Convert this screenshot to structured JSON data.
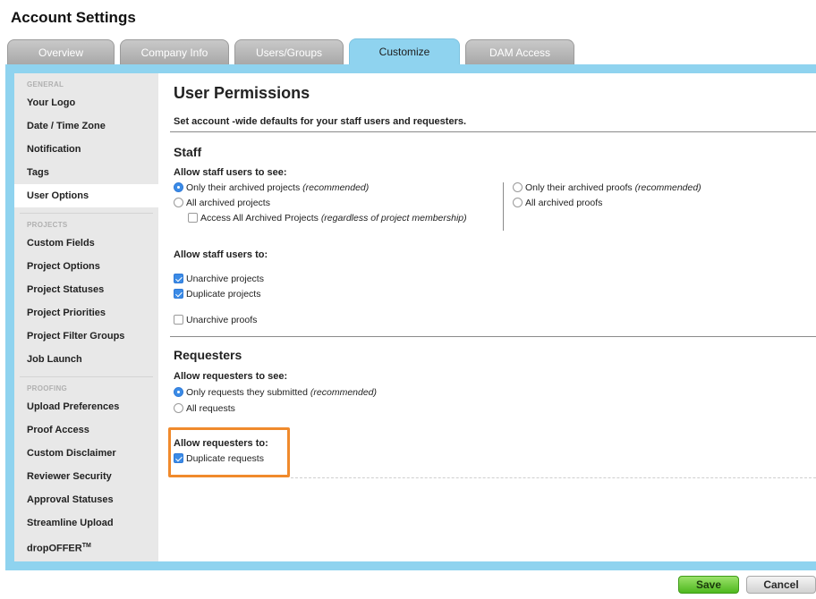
{
  "page_title": "Account Settings",
  "tabs": [
    {
      "label": "Overview"
    },
    {
      "label": "Company Info"
    },
    {
      "label": "Users/Groups"
    },
    {
      "label": "Customize"
    },
    {
      "label": "DAM Access"
    }
  ],
  "active_tab": "Customize",
  "sidebar": {
    "groups": [
      {
        "label": "GENERAL",
        "items": [
          "Your Logo",
          "Date / Time Zone",
          "Notification",
          "Tags",
          "User Options"
        ]
      },
      {
        "label": "PROJECTS",
        "items": [
          "Custom Fields",
          "Project Options",
          "Project Statuses",
          "Project Priorities",
          "Project Filter Groups",
          "Job Launch"
        ]
      },
      {
        "label": "PROOFING",
        "items": [
          "Upload Preferences",
          "Proof Access",
          "Custom Disclaimer",
          "Reviewer Security",
          "Approval Statuses",
          "Streamline Upload",
          "dropOFFER"
        ]
      }
    ],
    "trademark": "TM",
    "active_item": "User Options"
  },
  "main": {
    "title": "User Permissions",
    "subtitle": "Set account -wide defaults for your staff users and requesters.",
    "staff": {
      "heading": "Staff",
      "see_label": "Allow staff users to see:",
      "projects_options": [
        {
          "text": "Only their archived projects",
          "note": "(recommended)",
          "selected": true
        },
        {
          "text": "All archived projects",
          "note": "",
          "selected": false
        }
      ],
      "access_all": {
        "text": "Access All Archived Projects",
        "note": "(regardless of project membership)",
        "checked": false
      },
      "proofs_options": [
        {
          "text": "Only their archived proofs",
          "note": "(recommended)",
          "selected": false
        },
        {
          "text": "All archived proofs",
          "note": "",
          "selected": false
        }
      ],
      "to_label": "Allow staff users to:",
      "actions": [
        {
          "text": "Unarchive projects",
          "checked": true
        },
        {
          "text": "Duplicate projects",
          "checked": true
        },
        {
          "text": "Unarchive proofs",
          "checked": false
        }
      ]
    },
    "requesters": {
      "heading": "Requesters",
      "see_label": "Allow requesters to see:",
      "options": [
        {
          "text": "Only requests they submitted",
          "note": "(recommended)",
          "selected": true
        },
        {
          "text": "All requests",
          "note": "",
          "selected": false
        }
      ],
      "to_label": "Allow requesters to:",
      "actions": [
        {
          "text": "Duplicate requests",
          "checked": true
        }
      ]
    }
  },
  "buttons": {
    "save": "Save",
    "cancel": "Cancel"
  },
  "colors": {
    "tab_active": "#8fd3ef",
    "highlight": "#f08a2c",
    "save": "#4fb81f",
    "accent": "#3b8be6"
  }
}
